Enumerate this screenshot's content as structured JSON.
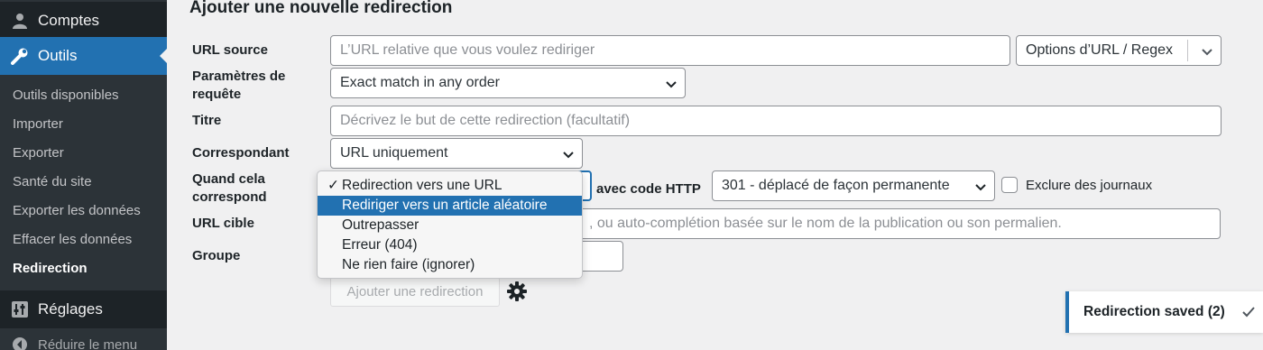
{
  "sidebar": {
    "comptes": "Comptes",
    "outils": "Outils",
    "sub_items": [
      "Outils disponibles",
      "Importer",
      "Exporter",
      "Santé du site",
      "Exporter les données",
      "Effacer les données",
      "Redirection"
    ],
    "reglages": "Réglages",
    "reduire": "Réduire le menu"
  },
  "page": {
    "title": "Ajouter une nouvelle redirection"
  },
  "form": {
    "url_source_label": "URL source",
    "url_source_placeholder": "L’URL relative que vous voulez rediriger",
    "url_options": "Options d’URL / Regex",
    "query_label_line1": "Paramètres de",
    "query_label_line2": "requête",
    "query_value": "Exact match in any order",
    "title_label": "Titre",
    "title_placeholder": "Décrivez le but de cette redirection (facultatif)",
    "match_label": "Correspondant",
    "match_value": "URL uniquement",
    "when_label_line1": "Quand cela",
    "when_label_line2": "correspond",
    "http_code_label": "avec code HTTP",
    "http_code_value": "301 - déplacé de façon permanente",
    "exclude_logs": "Exclure des journaux",
    "target_label": "URL cible",
    "target_placeholder_visible": ", ou auto-complétion basée sur le nom de la publication ou son permalien.",
    "group_label": "Groupe",
    "add_button": "Ajouter une redirection"
  },
  "dropdown": {
    "items": [
      "Redirection vers une URL",
      "Rediriger vers un article aléatoire",
      "Outrepasser",
      "Erreur (404)",
      "Ne rien faire (ignorer)"
    ],
    "checked_index": 0,
    "highlighted_index": 1
  },
  "notice": {
    "text": "Redirection saved (2)"
  },
  "colors": {
    "accent": "#2271b1",
    "sidebar": "#2c3338",
    "sidebar_dark": "#1d2327"
  }
}
